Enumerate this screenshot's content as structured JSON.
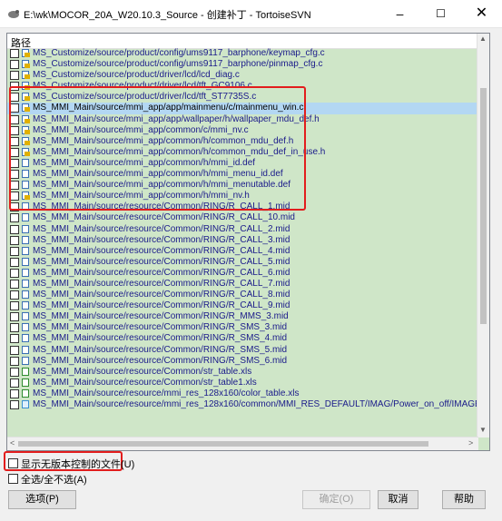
{
  "window": {
    "title": "E:\\wk\\MOCOR_20A_W20.10.3_Source - 创建补丁 - TortoiseSVN",
    "minimize": "–",
    "maximize": "☐",
    "close": "✕"
  },
  "list": {
    "header": "路径",
    "rows": [
      {
        "text": "MS_Customize/source/product/config/ums9117_barphone/keymap_cfg.c",
        "icon": "mod"
      },
      {
        "text": "MS_Customize/source/product/config/ums9117_barphone/pinmap_cfg.c",
        "icon": "mod"
      },
      {
        "text": "MS_Customize/source/product/driver/lcd/lcd_diag.c",
        "icon": "mod"
      },
      {
        "text": "MS_Customize/source/product/driver/lcd/tft_GC9106.c",
        "icon": "mod"
      },
      {
        "text": "MS_Customize/source/product/driver/lcd/tft_ST7735S.c",
        "icon": "mod"
      },
      {
        "text": "MS_MMI_Main/source/mmi_app/app/mainmenu/c/mainmenu_win.c",
        "icon": "mod",
        "selected": true
      },
      {
        "text": "MS_MMI_Main/source/mmi_app/app/wallpaper/h/wallpaper_mdu_def.h",
        "icon": "mod"
      },
      {
        "text": "MS_MMI_Main/source/mmi_app/common/c/mmi_nv.c",
        "icon": "mod"
      },
      {
        "text": "MS_MMI_Main/source/mmi_app/common/h/common_mdu_def.h",
        "icon": "mod"
      },
      {
        "text": "MS_MMI_Main/source/mmi_app/common/h/common_mdu_def_in_use.h",
        "icon": "mod"
      },
      {
        "text": "MS_MMI_Main/source/mmi_app/common/h/mmi_id.def",
        "icon": "file"
      },
      {
        "text": "MS_MMI_Main/source/mmi_app/common/h/mmi_menu_id.def",
        "icon": "file"
      },
      {
        "text": "MS_MMI_Main/source/mmi_app/common/h/mmi_menutable.def",
        "icon": "file"
      },
      {
        "text": "MS_MMI_Main/source/mmi_app/common/h/mmi_nv.h",
        "icon": "mod"
      },
      {
        "text": "MS_MMI_Main/source/resource/Common/RING/R_CALL_1.mid",
        "icon": "file"
      },
      {
        "text": "MS_MMI_Main/source/resource/Common/RING/R_CALL_10.mid",
        "icon": "file"
      },
      {
        "text": "MS_MMI_Main/source/resource/Common/RING/R_CALL_2.mid",
        "icon": "file"
      },
      {
        "text": "MS_MMI_Main/source/resource/Common/RING/R_CALL_3.mid",
        "icon": "file"
      },
      {
        "text": "MS_MMI_Main/source/resource/Common/RING/R_CALL_4.mid",
        "icon": "file"
      },
      {
        "text": "MS_MMI_Main/source/resource/Common/RING/R_CALL_5.mid",
        "icon": "file"
      },
      {
        "text": "MS_MMI_Main/source/resource/Common/RING/R_CALL_6.mid",
        "icon": "file"
      },
      {
        "text": "MS_MMI_Main/source/resource/Common/RING/R_CALL_7.mid",
        "icon": "file"
      },
      {
        "text": "MS_MMI_Main/source/resource/Common/RING/R_CALL_8.mid",
        "icon": "file"
      },
      {
        "text": "MS_MMI_Main/source/resource/Common/RING/R_CALL_9.mid",
        "icon": "file"
      },
      {
        "text": "MS_MMI_Main/source/resource/Common/RING/R_MMS_3.mid",
        "icon": "file"
      },
      {
        "text": "MS_MMI_Main/source/resource/Common/RING/R_SMS_3.mid",
        "icon": "file"
      },
      {
        "text": "MS_MMI_Main/source/resource/Common/RING/R_SMS_4.mid",
        "icon": "file"
      },
      {
        "text": "MS_MMI_Main/source/resource/Common/RING/R_SMS_5.mid",
        "icon": "file"
      },
      {
        "text": "MS_MMI_Main/source/resource/Common/RING/R_SMS_6.mid",
        "icon": "file"
      },
      {
        "text": "MS_MMI_Main/source/resource/Common/str_table.xls",
        "icon": "xls"
      },
      {
        "text": "MS_MMI_Main/source/resource/Common/str_table1.xls",
        "icon": "xls"
      },
      {
        "text": "MS_MMI_Main/source/resource/mmi_res_128x160/color_table.xls",
        "icon": "xls"
      },
      {
        "text": "MS_MMI_Main/source/resource/mmi_res_128x160/common/MMI_RES_DEFAULT/IMAG/Power_on_off/IMAGE_POWER_OFF.gif",
        "icon": "gif"
      }
    ]
  },
  "options": {
    "show_unversioned": "显示无版本控制的文件(U)",
    "select_all": "全选/全不选(A)"
  },
  "buttons": {
    "options": "选项(P)",
    "ok": "确定(O)",
    "cancel": "取消",
    "help": "帮助"
  },
  "scroll": {
    "up": "▲",
    "down": "▼",
    "left": "<",
    "right": ">"
  },
  "colors": {
    "list_bg": "#cfe6c8",
    "selected": "#b3d7f3",
    "annotation": "#e21d1d"
  }
}
